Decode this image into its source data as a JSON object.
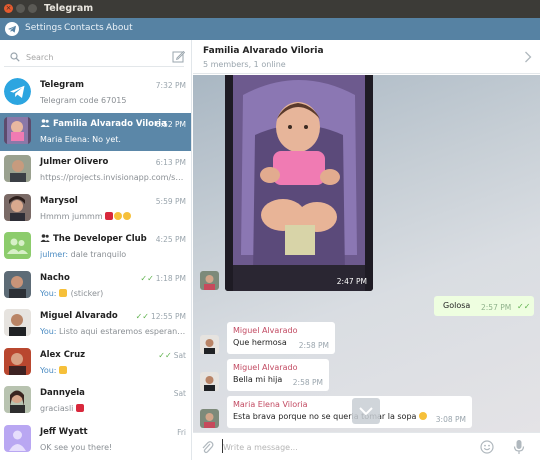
{
  "window": {
    "title": "Telegram"
  },
  "menu": {
    "items": [
      "Settings",
      "Contacts",
      "About"
    ]
  },
  "search": {
    "placeholder": "Search"
  },
  "chats": [
    {
      "name": "Telegram",
      "time": "7:32 PM",
      "preview": "Telegram code 67015",
      "group": false,
      "avatar": "telegram-logo"
    },
    {
      "name": "Familia Alvarado Viloria",
      "time": "6:52 PM",
      "preview": "Maria Elena: No yet.",
      "group": true,
      "active": true,
      "avatar": "baby-photo"
    },
    {
      "name": "Julmer Olivero",
      "time": "6:13 PM",
      "preview": "https://projects.invisionapp.com/sh...",
      "group": false,
      "avatar": "person-photo"
    },
    {
      "name": "Marysol",
      "time": "5:59 PM",
      "preview": "Hmmm jummm",
      "group": false,
      "avatar": "person-photo",
      "emojis": [
        "heart",
        "kiss",
        "kiss"
      ]
    },
    {
      "name": "The Developer Club",
      "time": "4:25 PM",
      "preview_who": "julmer:",
      "preview": "dale tranquilo",
      "group": true,
      "avatar": "green-placeholder"
    },
    {
      "name": "Nacho",
      "time": "1:18 PM",
      "preview_who": "You:",
      "preview": "(sticker)",
      "group": false,
      "read": true,
      "avatar": "person-photo",
      "emojis": [
        "thumbs-up"
      ]
    },
    {
      "name": "Miguel Alvarado",
      "time": "12:55 PM",
      "preview_who": "You:",
      "preview": "Listo aqui estaremos esperando",
      "group": false,
      "read": true,
      "avatar": "person-photo"
    },
    {
      "name": "Alex Cruz",
      "time": "Sat",
      "preview_who": "You:",
      "preview": "",
      "group": false,
      "read": true,
      "avatar": "person-photo",
      "emojis": [
        "thumbs-up"
      ]
    },
    {
      "name": "Dannyela",
      "time": "Sat",
      "preview": "graciasli",
      "group": false,
      "avatar": "person-photo",
      "emojis": [
        "heart"
      ]
    },
    {
      "name": "Jeff Wyatt",
      "time": "Fri",
      "preview": "OK see you there!",
      "group": false,
      "avatar": "purple-placeholder"
    }
  ],
  "conversation": {
    "title": "Familia Alvarado Viloria",
    "subtitle": "5 members, 1 online",
    "photo_time": "2:47 PM",
    "outgoing": {
      "text": "Golosa",
      "time": "2:57 PM"
    },
    "incoming": [
      {
        "sender": "Miguel Alvarado",
        "text": "Que hermosa",
        "time": "2:58 PM"
      },
      {
        "sender": "Miguel Alvarado",
        "text": "Bella mi hija",
        "time": "2:58 PM"
      },
      {
        "sender": "Maria Elena Viloria",
        "text": "Esta brava porque no se queria tomar la sopa",
        "time": "3:08 PM"
      }
    ]
  },
  "composer": {
    "placeholder": "Write a message..."
  },
  "colors": {
    "accent": "#5682a3",
    "active_chat": "#5b87a8",
    "sender_name": "#c24a62",
    "outgoing_bubble": "#eefee0",
    "read_check": "#5db14b"
  }
}
